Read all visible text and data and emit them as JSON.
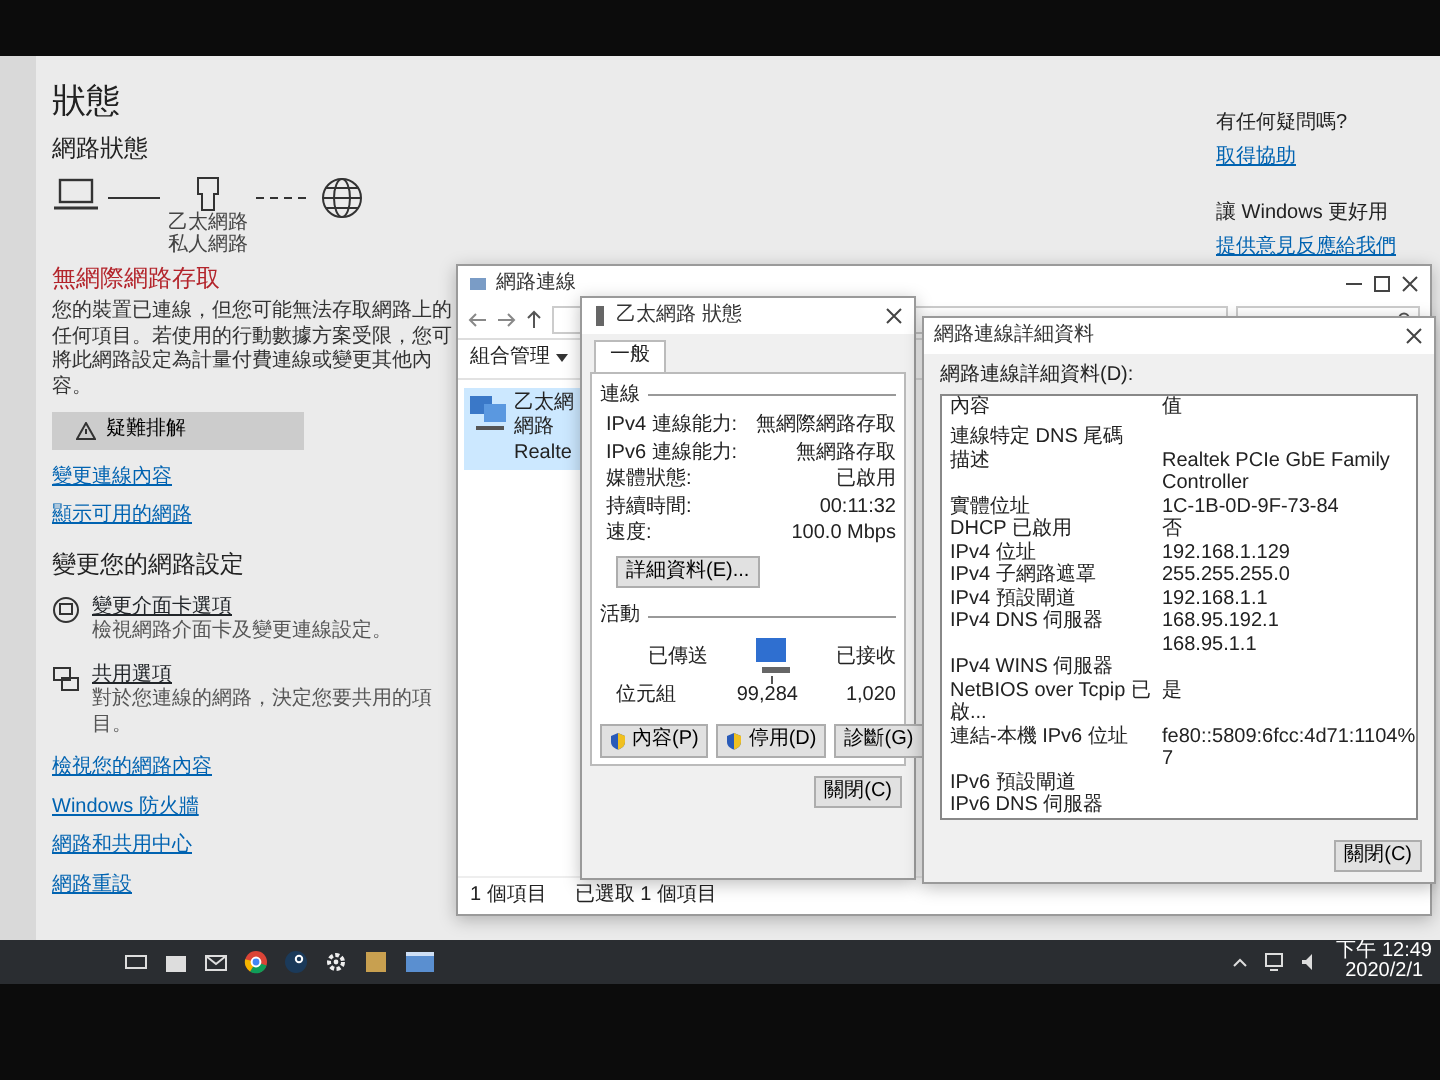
{
  "settings": {
    "title": "狀態",
    "section_title": "網路狀態",
    "diagram": {
      "adapter_label": "乙太網路",
      "profile_label": "私人網路"
    },
    "alert": {
      "title": "無網際網路存取",
      "message": "您的裝置已連線，但您可能無法存取網路上的任何項目。若使用的行動數據方案受限，您可將此網路設定為計量付費連線或變更其他內容。"
    },
    "troubleshoot_button": "疑難排解",
    "links": [
      "變更連線內容",
      "顯示可用的網路"
    ],
    "change_heading": "變更您的網路設定",
    "options": [
      {
        "kind": "adapter",
        "title": "變更介面卡選項",
        "description": "檢視網路介面卡及變更連線設定。"
      },
      {
        "kind": "sharing",
        "title": "共用選項",
        "description": "對於您連線的網路，決定您要共用的項目。"
      }
    ],
    "bottom_links": [
      "檢視您的網路內容",
      "Windows 防火牆",
      "網路和共用中心",
      "網路重設"
    ]
  },
  "help": {
    "question": "有任何疑問嗎?",
    "help_link": "取得協助",
    "feedback_heading": "讓 Windows 更好用",
    "feedback_link": "提供意見反應給我們"
  },
  "connections_window": {
    "title": "網路連線",
    "toolbar_menu": "組合管理",
    "item": {
      "lines": [
        "乙太網",
        "網路",
        "Realte"
      ],
      "selected": true
    },
    "status_items": [
      "1 個項目",
      "已選取 1 個項目"
    ]
  },
  "status_dialog": {
    "title": "乙太網路 狀態",
    "tabs": [
      {
        "label": "一般",
        "selected": true
      }
    ],
    "connection_group": "連線",
    "rows": [
      {
        "label": "IPv4 連線能力:",
        "value": "無網際網路存取"
      },
      {
        "label": "IPv6 連線能力:",
        "value": "無網路存取"
      },
      {
        "label": "媒體狀態:",
        "value": "已啟用"
      },
      {
        "label": "持續時間:",
        "value": "00:11:32"
      },
      {
        "label": "速度:",
        "value": "100.0 Mbps"
      }
    ],
    "details_button": "詳細資料(E)...",
    "activity_group": "活動",
    "sent_label": "已傳送",
    "received_label": "已接收",
    "bytes_label": "位元組",
    "bytes_sent": "99,284",
    "bytes_received": "1,020",
    "buttons": [
      {
        "label": "內容(P)",
        "shield": true
      },
      {
        "label": "停用(D)",
        "shield": true
      },
      {
        "label": "診斷(G)",
        "shield": false
      }
    ],
    "close_button": "關閉(C)"
  },
  "details_dialog": {
    "title": "網路連線詳細資料",
    "list_label": "網路連線詳細資料(D):",
    "columns": [
      "內容",
      "值"
    ],
    "rows": [
      {
        "property": "連線特定 DNS 尾碼"
      },
      {
        "property": "描述",
        "value": "Realtek PCIe GbE Family Controller"
      },
      {
        "property": "實體位址",
        "value": "1C-1B-0D-9F-73-84"
      },
      {
        "property": "DHCP 已啟用",
        "value": "否"
      },
      {
        "property": "IPv4 位址",
        "value": "192.168.1.129"
      },
      {
        "property": "IPv4 子網路遮罩",
        "value": "255.255.255.0"
      },
      {
        "property": "IPv4 預設閘道",
        "value": "192.168.1.1"
      },
      {
        "property": "IPv4 DNS 伺服器",
        "value": "168.95.192.1"
      },
      {
        "value": "168.95.1.1"
      },
      {
        "property": "IPv4 WINS 伺服器"
      },
      {
        "property": "NetBIOS over Tcpip 已啟...",
        "value": "是"
      },
      {
        "property": "連結-本機 IPv6 位址",
        "value": "fe80::5809:6fcc:4d71:1104%7"
      },
      {
        "property": "IPv6 預設閘道"
      },
      {
        "property": "IPv6 DNS 伺服器"
      }
    ],
    "close_button": "關閉(C)"
  },
  "taskbar": {
    "time": "下午 12:49",
    "date": "2020/2/1"
  }
}
